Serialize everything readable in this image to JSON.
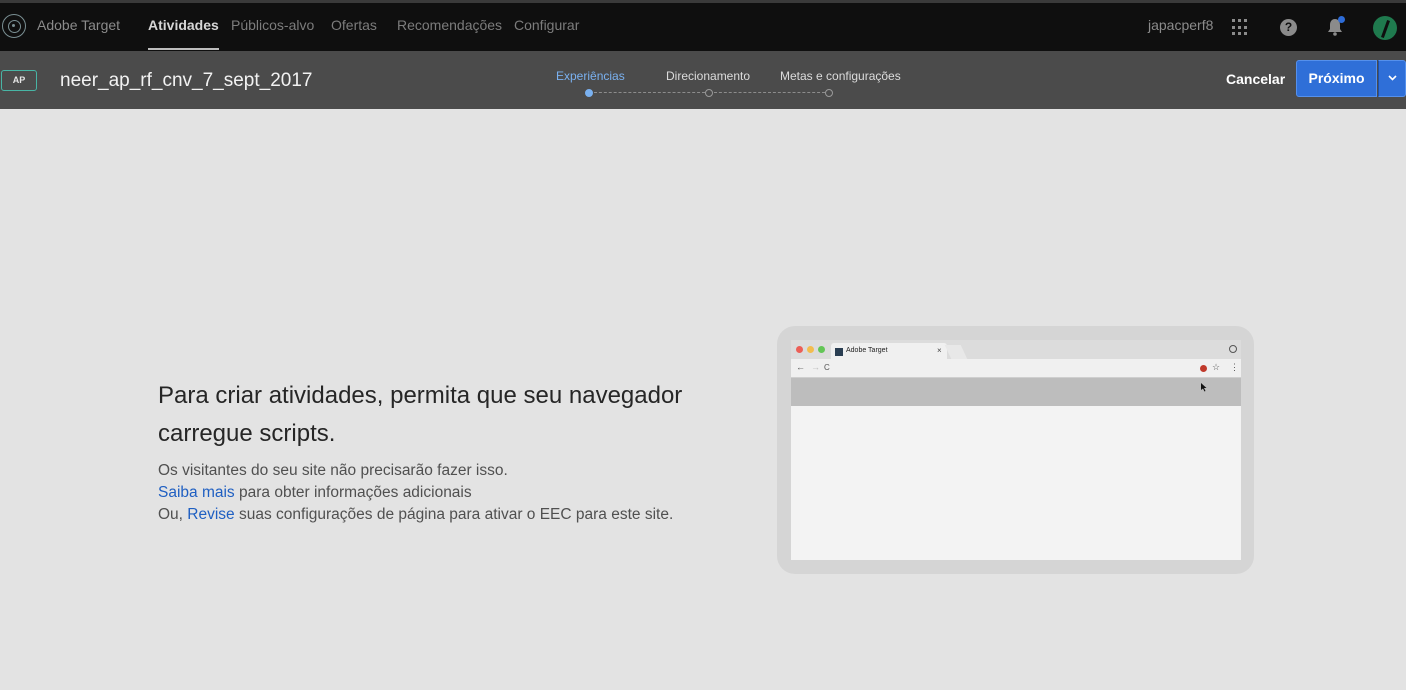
{
  "topnav": {
    "brand": "Adobe Target",
    "items": [
      {
        "label": "Atividades",
        "active": true
      },
      {
        "label": "Públicos-alvo",
        "active": false
      },
      {
        "label": "Ofertas",
        "active": false
      },
      {
        "label": "Recomendações",
        "active": false
      },
      {
        "label": "Configurar",
        "active": false
      }
    ],
    "user": "japacperf8",
    "icons": [
      "adobe-target-logo-icon",
      "apps-grid-icon",
      "help-icon",
      "notifications-bell-icon",
      "user-avatar"
    ]
  },
  "activity": {
    "type_badge": "AP",
    "name": "neer_ap_rf_cnv_7_sept_2017",
    "steps": [
      {
        "label": "Experiências",
        "active": true
      },
      {
        "label": "Direcionamento",
        "active": false
      },
      {
        "label": "Metas e configurações",
        "active": false
      }
    ],
    "cancel_label": "Cancelar",
    "next_label": "Próximo"
  },
  "message": {
    "headline": "Para criar atividades, permita que seu navegador carregue scripts.",
    "line1": "Os visitantes do seu site não precisarão fazer isso.",
    "line2_link": "Saiba mais",
    "line2_rest": " para obter informações adicionais",
    "line3_prefix": "Ou, ",
    "line3_link": "Revise",
    "line3_rest": " suas configurações de página para ativar o EEC para este site."
  },
  "illustration": {
    "tab_title": "Adobe Target",
    "tab_close": "×",
    "nav_back": "←",
    "nav_forward": "→",
    "nav_reload": "C",
    "star": "☆",
    "menu": "⋮"
  },
  "colors": {
    "accent": "#2f6fd8",
    "active_step": "#7ab1f0",
    "badge_border": "#48b5a5",
    "link": "#1f5fc2"
  }
}
